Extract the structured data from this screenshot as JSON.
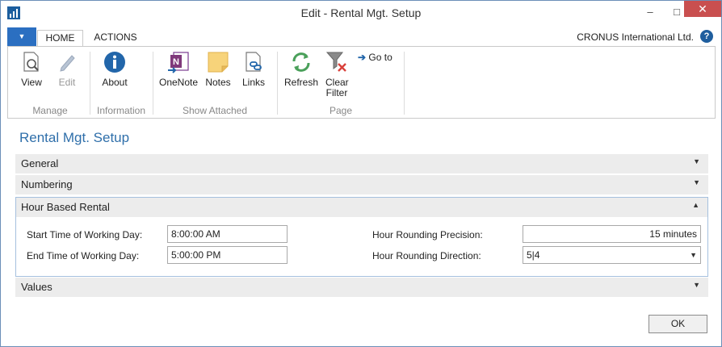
{
  "window": {
    "title": "Edit - Rental Mgt. Setup",
    "minimize_glyph": "–",
    "maximize_glyph": "□",
    "close_glyph": "✕"
  },
  "ribbon": {
    "file_glyph": "▼",
    "tabs": [
      {
        "label": "HOME",
        "active": true
      },
      {
        "label": "ACTIONS",
        "active": false
      }
    ],
    "company": "CRONUS International Ltd.",
    "help_glyph": "?",
    "groups": [
      {
        "label": "Manage",
        "buttons": [
          {
            "label": "View",
            "icon": "view-icon"
          },
          {
            "label": "Edit",
            "icon": "edit-icon",
            "disabled": true
          }
        ]
      },
      {
        "label": "Information",
        "buttons": [
          {
            "label": "About",
            "icon": "info-icon"
          }
        ]
      },
      {
        "label": "Show Attached",
        "buttons": [
          {
            "label": "OneNote",
            "icon": "onenote-icon"
          },
          {
            "label": "Notes",
            "icon": "notes-icon"
          },
          {
            "label": "Links",
            "icon": "links-icon"
          }
        ]
      },
      {
        "label": "Page",
        "buttons": [
          {
            "label": "Refresh",
            "icon": "refresh-icon"
          },
          {
            "label": "Clear Filter",
            "icon": "clear-filter-icon"
          },
          {
            "label": "Go to",
            "icon": "go-to-arrow-icon"
          }
        ]
      }
    ]
  },
  "page": {
    "title": "Rental Mgt. Setup",
    "fasttabs": {
      "general": "General",
      "numbering": "Numbering",
      "hour_based_rental": "Hour Based Rental",
      "values": "Values"
    },
    "collapsed_glyph": "⌄",
    "expanded_glyph": "⌃",
    "fields": {
      "start_time_label": "Start Time of Working Day:",
      "start_time_value": "8:00:00 AM",
      "end_time_label": "End Time of Working Day:",
      "end_time_value": "5:00:00 PM",
      "rounding_precision_label": "Hour Rounding Precision:",
      "rounding_precision_value": "15 minutes",
      "rounding_direction_label": "Hour Rounding Direction:",
      "rounding_direction_value": "5|4"
    },
    "ok_label": "OK"
  },
  "colors": {
    "accent": "#2b6fc1",
    "title_blue": "#2f6faa",
    "close_red": "#c94f4f",
    "fasttab_bg": "#ececec"
  }
}
